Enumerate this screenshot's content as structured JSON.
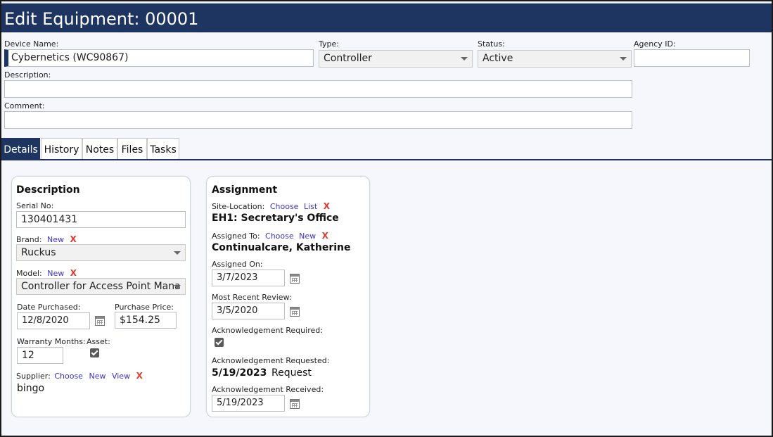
{
  "header": {
    "title": "Edit Equipment: 00001"
  },
  "form": {
    "device_name_label": "Device Name:",
    "device_name_value": "Cybernetics (WC90867)",
    "type_label": "Type:",
    "type_value": "Controller",
    "status_label": "Status:",
    "status_value": "Active",
    "agency_id_label": "Agency ID:",
    "agency_id_value": "",
    "description_label": "Description:",
    "description_value": "",
    "comment_label": "Comment:",
    "comment_value": ""
  },
  "tabs": [
    {
      "label": "Details",
      "active": true
    },
    {
      "label": "History"
    },
    {
      "label": "Notes"
    },
    {
      "label": "Files"
    },
    {
      "label": "Tasks"
    }
  ],
  "description_card": {
    "title": "Description",
    "serial_label": "Serial No:",
    "serial_value": "130401431",
    "brand_label": "Brand:",
    "brand_new": "New",
    "brand_value": "Ruckus",
    "model_label": "Model:",
    "model_new": "New",
    "model_value": "Controller for Access Point Mana",
    "date_purchased_label": "Date Purchased:",
    "date_purchased_value": "12/8/2020",
    "purchase_price_label": "Purchase Price:",
    "purchase_price_value": "$154.25",
    "warranty_label": "Warranty Months:",
    "warranty_value": "12",
    "asset_label": "Asset:",
    "supplier_label": "Supplier:",
    "supplier_choose": "Choose",
    "supplier_new": "New",
    "supplier_view": "View",
    "supplier_value": "bingo",
    "remove_glyph": "X"
  },
  "assignment_card": {
    "title": "Assignment",
    "site_label": "Site-Location:",
    "site_choose": "Choose",
    "site_list": "List",
    "site_value": "EH1: Secretary's Office",
    "assigned_to_label": "Assigned To:",
    "assigned_to_choose": "Choose",
    "assigned_to_new": "New",
    "assigned_to_value": "Continualcare, Katherine",
    "assigned_on_label": "Assigned On:",
    "assigned_on_value": "3/7/2023",
    "recent_review_label": "Most Recent Review:",
    "recent_review_value": "3/5/2020",
    "ack_required_label": "Acknowledgement Required:",
    "ack_requested_label": "Acknowledgement Requested:",
    "ack_requested_value": "5/19/2023",
    "ack_request_link": "Request",
    "ack_received_label": "Acknowledgement Received:",
    "ack_received_value": "5/19/2023",
    "remove_glyph": "X"
  },
  "colors": {
    "header_bg": "#1e3561",
    "link": "#3b34c7",
    "remove": "#e03a2f",
    "page_bg": "#f5f7fd"
  },
  "icons": {
    "calendar": "calendar-icon",
    "checkbox": "checkbox-checked-icon",
    "dropdown": "chevron-down-icon"
  }
}
